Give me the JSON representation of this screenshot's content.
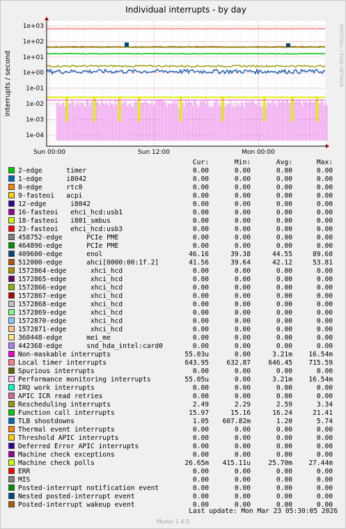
{
  "chart_data": {
    "type": "line",
    "title": "Individual interrupts - by day",
    "ylabel": "interrupts / second",
    "yscale": "log",
    "ylim": [
      3e-05,
      1000
    ],
    "y_ticks": [
      "1e+03",
      "1e+02",
      "1e+01",
      "1e+00",
      "1e-01",
      "1e-02",
      "1e-03",
      "1e-04"
    ],
    "x_ticks": [
      "Sun 00:00",
      "Sun 12:00",
      "Mon 00:00"
    ],
    "side_label": "RRDTOOL / TOBI OETIKER",
    "grid": true,
    "series_approx": [
      {
        "name": "Local timer interrupts",
        "color": "#f47a7a",
        "level": 640
      },
      {
        "name": "Rescheduling interrupts",
        "color": "#7f3f00",
        "level": 2.6
      },
      {
        "name": "Function call interrupts",
        "color": "#00c000",
        "level": 16
      },
      {
        "name": "409600-edge enol",
        "color": "#0060c0",
        "level": 44,
        "spike_sun_08": 85
      },
      {
        "name": "512000-edge ahci",
        "color": "#808000",
        "level": 42
      },
      {
        "name": "TLB shootdowns",
        "color": "#2060b0",
        "level": 1.2
      },
      {
        "name": "Machine check polls",
        "color": "#e0f000",
        "level": 0.026
      },
      {
        "name": "Performance monitoring interrupts",
        "color": "#f0a0f0",
        "level": 0.003
      }
    ]
  },
  "legend": {
    "headers": {
      "cur": "Cur:",
      "min": "Min:",
      "avg": "Avg:",
      "max": "Max:"
    },
    "rows": [
      {
        "name": "2-edge      timer",
        "color": "#00cc00",
        "cur": "0.00",
        "min": "0.00",
        "avg": "0.00",
        "max": "0.00"
      },
      {
        "name": "1-edge      i8042",
        "color": "#0066b3",
        "cur": "0.00",
        "min": "0.00",
        "avg": "0.00",
        "max": "0.00"
      },
      {
        "name": "8-edge      rtc0",
        "color": "#ff8000",
        "cur": "0.00",
        "min": "0.00",
        "avg": "0.00",
        "max": "0.00"
      },
      {
        "name": "9-fasteoi   acpi",
        "color": "#ffcc00",
        "cur": "0.00",
        "min": "0.00",
        "avg": "0.00",
        "max": "0.00"
      },
      {
        "name": "12-edge      i8042",
        "color": "#330099",
        "cur": "0.00",
        "min": "0.00",
        "avg": "0.00",
        "max": "0.00"
      },
      {
        "name": "16-fasteoi   ehci_hcd:usb1",
        "color": "#990099",
        "cur": "0.00",
        "min": "0.00",
        "avg": "0.00",
        "max": "0.00"
      },
      {
        "name": "18-fasteoi   i801_smbus",
        "color": "#ccff00",
        "cur": "0.00",
        "min": "0.00",
        "avg": "0.00",
        "max": "0.00"
      },
      {
        "name": "23-fasteoi   ehci_hcd:usb3",
        "color": "#ff0000",
        "cur": "0.00",
        "min": "0.00",
        "avg": "0.00",
        "max": "0.00"
      },
      {
        "name": "458752-edge      PCIe PME",
        "color": "#808080",
        "cur": "0.00",
        "min": "0.00",
        "avg": "0.00",
        "max": "0.00"
      },
      {
        "name": "464896-edge      PCIe PME",
        "color": "#008f00",
        "cur": "0.00",
        "min": "0.00",
        "avg": "0.00",
        "max": "0.00"
      },
      {
        "name": "409600-edge      enol",
        "color": "#00487d",
        "cur": "46.16",
        "min": "39.38",
        "avg": "44.55",
        "max": "89.60"
      },
      {
        "name": "512000-edge      ahci[0000:00:1f.2]",
        "color": "#b35a00",
        "cur": "41.56",
        "min": "39.64",
        "avg": "42.12",
        "max": "53.81"
      },
      {
        "name": "1572864-edge      xhci_hcd",
        "color": "#b38f00",
        "cur": "0.00",
        "min": "0.00",
        "avg": "0.00",
        "max": "0.00"
      },
      {
        "name": "1572865-edge      xhci_hcd",
        "color": "#6b006b",
        "cur": "0.00",
        "min": "0.00",
        "avg": "0.00",
        "max": "0.00"
      },
      {
        "name": "1572866-edge      xhci_hcd",
        "color": "#8fb300",
        "cur": "0.00",
        "min": "0.00",
        "avg": "0.00",
        "max": "0.00"
      },
      {
        "name": "1572867-edge      xhci_hcd",
        "color": "#b30000",
        "cur": "0.00",
        "min": "0.00",
        "avg": "0.00",
        "max": "0.00"
      },
      {
        "name": "1572868-edge      xhci_hcd",
        "color": "#bebebe",
        "cur": "0.00",
        "min": "0.00",
        "avg": "0.00",
        "max": "0.00"
      },
      {
        "name": "1572869-edge      xhci_hcd",
        "color": "#80ff80",
        "cur": "0.00",
        "min": "0.00",
        "avg": "0.00",
        "max": "0.00"
      },
      {
        "name": "1572870-edge      xhci_hcd",
        "color": "#80c9ff",
        "cur": "0.00",
        "min": "0.00",
        "avg": "0.00",
        "max": "0.00"
      },
      {
        "name": "1572871-edge      xhci_hcd",
        "color": "#ffc080",
        "cur": "0.00",
        "min": "0.00",
        "avg": "0.00",
        "max": "0.00"
      },
      {
        "name": "360448-edge      mei_me",
        "color": "#ffe680",
        "cur": "0.00",
        "min": "0.00",
        "avg": "0.00",
        "max": "0.00"
      },
      {
        "name": "442368-edge      snd_hda_intel:card0",
        "color": "#aa80ff",
        "cur": "0.00",
        "min": "0.00",
        "avg": "0.00",
        "max": "0.00"
      },
      {
        "name": "Non-maskable interrupts",
        "color": "#ee00cc",
        "cur": "55.03u",
        "min": "0.00",
        "avg": "3.21m",
        "max": "16.54m"
      },
      {
        "name": "Local timer interrupts",
        "color": "#ff8080",
        "cur": "643.95",
        "min": "632.87",
        "avg": "646.45",
        "max": "715.59"
      },
      {
        "name": "Spurious interrupts",
        "color": "#666600",
        "cur": "0.00",
        "min": "0.00",
        "avg": "0.00",
        "max": "0.00"
      },
      {
        "name": "Performance monitoring interrupts",
        "color": "#ffbfff",
        "cur": "55.05u",
        "min": "0.00",
        "avg": "3.21m",
        "max": "16.54m"
      },
      {
        "name": "IRQ work interrupts",
        "color": "#00ffcc",
        "cur": "0.00",
        "min": "0.00",
        "avg": "0.00",
        "max": "0.00"
      },
      {
        "name": "APIC ICR read retries",
        "color": "#cc6699",
        "cur": "0.00",
        "min": "0.00",
        "avg": "0.00",
        "max": "0.00"
      },
      {
        "name": "Rescheduling interrupts",
        "color": "#999900",
        "cur": "2.49",
        "min": "2.29",
        "avg": "2.59",
        "max": "3.34"
      },
      {
        "name": "Function call interrupts",
        "color": "#00cc00",
        "cur": "15.97",
        "min": "15.16",
        "avg": "16.24",
        "max": "21.41"
      },
      {
        "name": "TLB shootdowns",
        "color": "#0066b3",
        "cur": "1.05",
        "min": "607.82m",
        "avg": "1.20",
        "max": "5.74"
      },
      {
        "name": "Thermal event interrupts",
        "color": "#ff8000",
        "cur": "0.00",
        "min": "0.00",
        "avg": "0.00",
        "max": "0.00"
      },
      {
        "name": "Threshold APIC interrupts",
        "color": "#ffcc00",
        "cur": "0.00",
        "min": "0.00",
        "avg": "0.00",
        "max": "0.00"
      },
      {
        "name": "Deferred Error APIC interrupts",
        "color": "#330099",
        "cur": "0.00",
        "min": "0.00",
        "avg": "0.00",
        "max": "0.00"
      },
      {
        "name": "Machine check exceptions",
        "color": "#990099",
        "cur": "0.00",
        "min": "0.00",
        "avg": "0.00",
        "max": "0.00"
      },
      {
        "name": "Machine check polls",
        "color": "#ccff00",
        "cur": "26.65m",
        "min": "415.11u",
        "avg": "25.70m",
        "max": "27.44m"
      },
      {
        "name": "ERR",
        "color": "#ff0000",
        "cur": "0.00",
        "min": "0.00",
        "avg": "0.00",
        "max": "0.00"
      },
      {
        "name": "MIS",
        "color": "#808080",
        "cur": "0.00",
        "min": "0.00",
        "avg": "0.00",
        "max": "0.00"
      },
      {
        "name": "Posted-interrupt notification event",
        "color": "#008f00",
        "cur": "0.00",
        "min": "0.00",
        "avg": "0.00",
        "max": "0.00"
      },
      {
        "name": "Nested posted-interrupt event",
        "color": "#00487d",
        "cur": "0.00",
        "min": "0.00",
        "avg": "0.00",
        "max": "0.00"
      },
      {
        "name": "Posted-interrupt wakeup event",
        "color": "#b35a00",
        "cur": "0.00",
        "min": "0.00",
        "avg": "0.00",
        "max": "0.00"
      }
    ]
  },
  "footer": {
    "last_update": "Last update:  Mon Mar 23 05:30:05 2026",
    "version": "Munin 1.4.5"
  }
}
